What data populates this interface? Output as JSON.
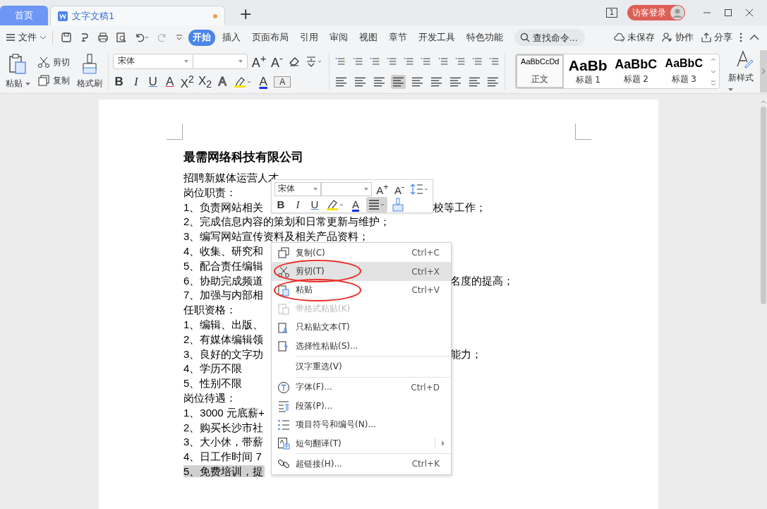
{
  "tabs": [
    {
      "label": "首页",
      "kind": "home",
      "selected": false
    },
    {
      "label": "文字文稿1",
      "kind": "doc",
      "selected": true,
      "unsaved": true
    }
  ],
  "new_tab": "+",
  "page_count": "1",
  "login": "访客登录",
  "menu": {
    "file": "文件",
    "ribbon_tabs": [
      {
        "label": "开始",
        "selected": true
      },
      {
        "label": "插入",
        "selected": false
      },
      {
        "label": "页面布局",
        "selected": false
      },
      {
        "label": "引用",
        "selected": false
      },
      {
        "label": "审阅",
        "selected": false
      },
      {
        "label": "视图",
        "selected": false
      },
      {
        "label": "章节",
        "selected": false
      },
      {
        "label": "开发工具",
        "selected": false
      },
      {
        "label": "特色功能",
        "selected": false
      }
    ],
    "search": {
      "placeholder": "查找命令..."
    },
    "actions": [
      {
        "kind": "cloud",
        "label": "未保存"
      },
      {
        "kind": "collab",
        "label": "协作"
      },
      {
        "kind": "share",
        "label": "分享"
      }
    ]
  },
  "ribbon": {
    "paste": "粘贴",
    "cut": "剪切",
    "copy": "复制",
    "painter": "格式刷",
    "font": "宋体",
    "font_top": [
      {
        "label": "A$^{+}$"
      },
      {
        "label": "A$^{-}$"
      }
    ],
    "format": [
      {
        "kind": "bold",
        "label": "B"
      },
      {
        "kind": "italic",
        "label": "I"
      },
      {
        "kind": "underline",
        "label": "U"
      },
      {
        "kind": "strike",
        "label": "A"
      },
      {
        "kind": "plain",
        "label": "X$^{2}$"
      },
      {
        "kind": "plain",
        "label": "X$_{2}$"
      },
      {
        "kind": "outline",
        "label": "A"
      },
      {
        "kind": "highlight"
      },
      {
        "kind": "color",
        "label": "A"
      },
      {
        "kind": "shade",
        "label": "A"
      }
    ],
    "styles": [
      {
        "preview": "AaBbCcDd",
        "name": "正文",
        "kind": "body",
        "selected": true
      },
      {
        "preview": "AaBb",
        "name": "标题 1",
        "kind": "h1",
        "selected": false
      },
      {
        "preview": "AaBbC",
        "name": "标题 2",
        "kind": "h2",
        "selected": false
      },
      {
        "preview": "AaBbC",
        "name": "标题 3",
        "kind": "h3",
        "selected": false
      }
    ],
    "new_style": "新样式"
  },
  "document": {
    "title": "最需网络科技有限公司",
    "lines": [
      {
        "text": "招聘新媒体运营人才",
        "highlighted": false
      },
      {
        "text": "岗位职责：",
        "highlighted": false
      },
      {
        "text": "1、负责网站相关",
        "highlighted": false,
        "tail": "校等工作；"
      },
      {
        "text": "2、完成信息内容的策划和日常更新与维护；",
        "highlighted": false
      },
      {
        "text": "3、编写网站宣传资料及相关产品资料；",
        "highlighted": false
      },
      {
        "text": "4、收集、研究和",
        "highlighted": false
      },
      {
        "text": "5、配合责任编辑",
        "highlighted": false
      },
      {
        "text": "6、协助完成频道",
        "highlighted": false,
        "tail": "名度的提高；"
      },
      {
        "text": "7、加强与内部相",
        "highlighted": false
      },
      {
        "text": "任职资格：",
        "highlighted": false
      },
      {
        "text": "1、编辑、出版、",
        "highlighted": false
      },
      {
        "text": "2、有媒体编辑领",
        "highlighted": false
      },
      {
        "text": "3、良好的文字功",
        "highlighted": false,
        "tail": "能力；"
      },
      {
        "text": "4、学历不限",
        "highlighted": false
      },
      {
        "text": "5、性别不限",
        "highlighted": false
      },
      {
        "text": "岗位待遇：",
        "highlighted": false
      },
      {
        "text": "1、3000 元底薪+",
        "highlighted": false
      },
      {
        "text": "2、购买长沙市社",
        "highlighted": false
      },
      {
        "text": "3、大小休，带薪",
        "highlighted": false
      },
      {
        "text": "4、日工作时间 7",
        "highlighted": false
      },
      {
        "text": "5、免费培训，提",
        "highlighted": true
      }
    ]
  },
  "mini_toolbar": {
    "font": "宋体",
    "top": [
      {
        "label": "A$^{+}$"
      },
      {
        "label": "A$^{-}$"
      }
    ],
    "format": [
      {
        "kind": "bold",
        "label": "B"
      },
      {
        "kind": "italic",
        "label": "I"
      },
      {
        "kind": "underline",
        "label": "U"
      },
      {
        "kind": "highlight"
      },
      {
        "kind": "color",
        "label": "A"
      }
    ]
  },
  "context_menu": [
    {
      "kind": "item",
      "label": "复制(C)",
      "shortcut": "Ctrl+C",
      "disabled": false,
      "selected": false,
      "circled": false
    },
    {
      "kind": "item",
      "label": "剪切(T)",
      "shortcut": "Ctrl+X",
      "disabled": false,
      "selected": true,
      "circled": true
    },
    {
      "kind": "item",
      "label": "粘贴",
      "shortcut": "Ctrl+V",
      "disabled": false,
      "selected": false,
      "circled": true
    },
    {
      "kind": "item",
      "label": "带格式粘贴(K)",
      "disabled": true,
      "selected": false,
      "circled": false
    },
    {
      "kind": "item",
      "label": "只粘贴文本(T)",
      "disabled": false,
      "selected": false,
      "circled": false
    },
    {
      "kind": "item",
      "label": "选择性粘贴(S)...",
      "disabled": false,
      "selected": false,
      "circled": false
    },
    {
      "kind": "separator"
    },
    {
      "kind": "item",
      "label": "汉字重选(V)",
      "disabled": false,
      "selected": false,
      "circled": false
    },
    {
      "kind": "separator"
    },
    {
      "kind": "item",
      "label": "字体(F)...",
      "shortcut": "Ctrl+D",
      "disabled": false,
      "selected": false,
      "circled": false
    },
    {
      "kind": "item",
      "label": "段落(P)...",
      "disabled": false,
      "selected": false,
      "circled": false
    },
    {
      "kind": "item",
      "label": "项目符号和编号(N)...",
      "disabled": false,
      "selected": false,
      "circled": false
    },
    {
      "kind": "item",
      "label": "短句翻译(T)",
      "disabled": false,
      "selected": false,
      "circled": false,
      "submenu": true
    },
    {
      "kind": "separator"
    },
    {
      "kind": "item",
      "label": "超链接(H)...",
      "shortcut": "Ctrl+K",
      "disabled": false,
      "selected": false,
      "circled": false
    }
  ]
}
